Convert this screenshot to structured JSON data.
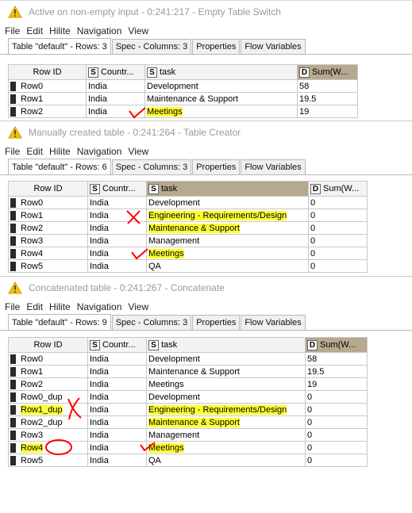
{
  "colors": {
    "highlight": "#ffff33",
    "mark_red": "#ff0000",
    "selected_header": "#b6a98d"
  },
  "windows": [
    {
      "title": "Active on non-empty input - 0:241:217 - Empty Table Switch",
      "menu": [
        "File",
        "Edit",
        "Hilite",
        "Navigation",
        "View"
      ],
      "tabs": [
        "Table \"default\" - Rows: 3",
        "Spec - Columns: 3",
        "Properties",
        "Flow Variables"
      ],
      "columns": [
        {
          "label": "Row ID",
          "type": ""
        },
        {
          "label": "Countr...",
          "type": "S"
        },
        {
          "label": "task",
          "type": "S"
        },
        {
          "label": "Sum(W...",
          "type": "D"
        }
      ],
      "rows": [
        {
          "id": "Row0",
          "country": "India",
          "task": "Development",
          "sum": "58"
        },
        {
          "id": "Row1",
          "country": "India",
          "task": "Maintenance & Support",
          "sum": "19.5"
        },
        {
          "id": "Row2",
          "country": "India",
          "task": "Meetings",
          "sum": "19"
        }
      ]
    },
    {
      "title": "Manually created table - 0:241:264 - Table Creator",
      "menu": [
        "File",
        "Edit",
        "Hilite",
        "Navigation",
        "View"
      ],
      "tabs": [
        "Table \"default\" - Rows: 6",
        "Spec - Columns: 3",
        "Properties",
        "Flow Variables"
      ],
      "columns": [
        {
          "label": "Row ID",
          "type": ""
        },
        {
          "label": "Countr...",
          "type": "S"
        },
        {
          "label": "task",
          "type": "S"
        },
        {
          "label": "Sum(W...",
          "type": "D"
        }
      ],
      "rows": [
        {
          "id": "Row0",
          "country": "India",
          "task": "Development",
          "sum": "0"
        },
        {
          "id": "Row1",
          "country": "India",
          "task": "Engineering - Requirements/Design",
          "sum": "0"
        },
        {
          "id": "Row2",
          "country": "India",
          "task": "Maintenance & Support",
          "sum": "0"
        },
        {
          "id": "Row3",
          "country": "India",
          "task": "Management",
          "sum": "0"
        },
        {
          "id": "Row4",
          "country": "India",
          "task": "Meetings",
          "sum": "0"
        },
        {
          "id": "Row5",
          "country": "India",
          "task": "QA",
          "sum": "0"
        }
      ]
    },
    {
      "title": "Concatenated table - 0:241:267 - Concatenate",
      "menu": [
        "File",
        "Edit",
        "Hilite",
        "Navigation",
        "View"
      ],
      "tabs": [
        "Table \"default\" - Rows: 9",
        "Spec - Columns: 3",
        "Properties",
        "Flow Variables"
      ],
      "columns": [
        {
          "label": "Row ID",
          "type": ""
        },
        {
          "label": "Countr...",
          "type": "S"
        },
        {
          "label": "task",
          "type": "S"
        },
        {
          "label": "Sum(W...",
          "type": "D"
        }
      ],
      "rows": [
        {
          "id": "Row0",
          "country": "India",
          "task": "Development",
          "sum": "58"
        },
        {
          "id": "Row1",
          "country": "India",
          "task": "Maintenance & Support",
          "sum": "19.5"
        },
        {
          "id": "Row2",
          "country": "India",
          "task": "Meetings",
          "sum": "19"
        },
        {
          "id": "Row0_dup",
          "country": "India",
          "task": "Development",
          "sum": "0"
        },
        {
          "id": "Row1_dup",
          "country": "India",
          "task": "Engineering - Requirements/Design",
          "sum": "0"
        },
        {
          "id": "Row2_dup",
          "country": "India",
          "task": "Maintenance & Support",
          "sum": "0"
        },
        {
          "id": "Row3",
          "country": "India",
          "task": "Management",
          "sum": "0"
        },
        {
          "id": "Row4",
          "country": "India",
          "task": "Meetings",
          "sum": "0"
        },
        {
          "id": "Row5",
          "country": "India",
          "task": "QA",
          "sum": "0"
        }
      ]
    }
  ]
}
